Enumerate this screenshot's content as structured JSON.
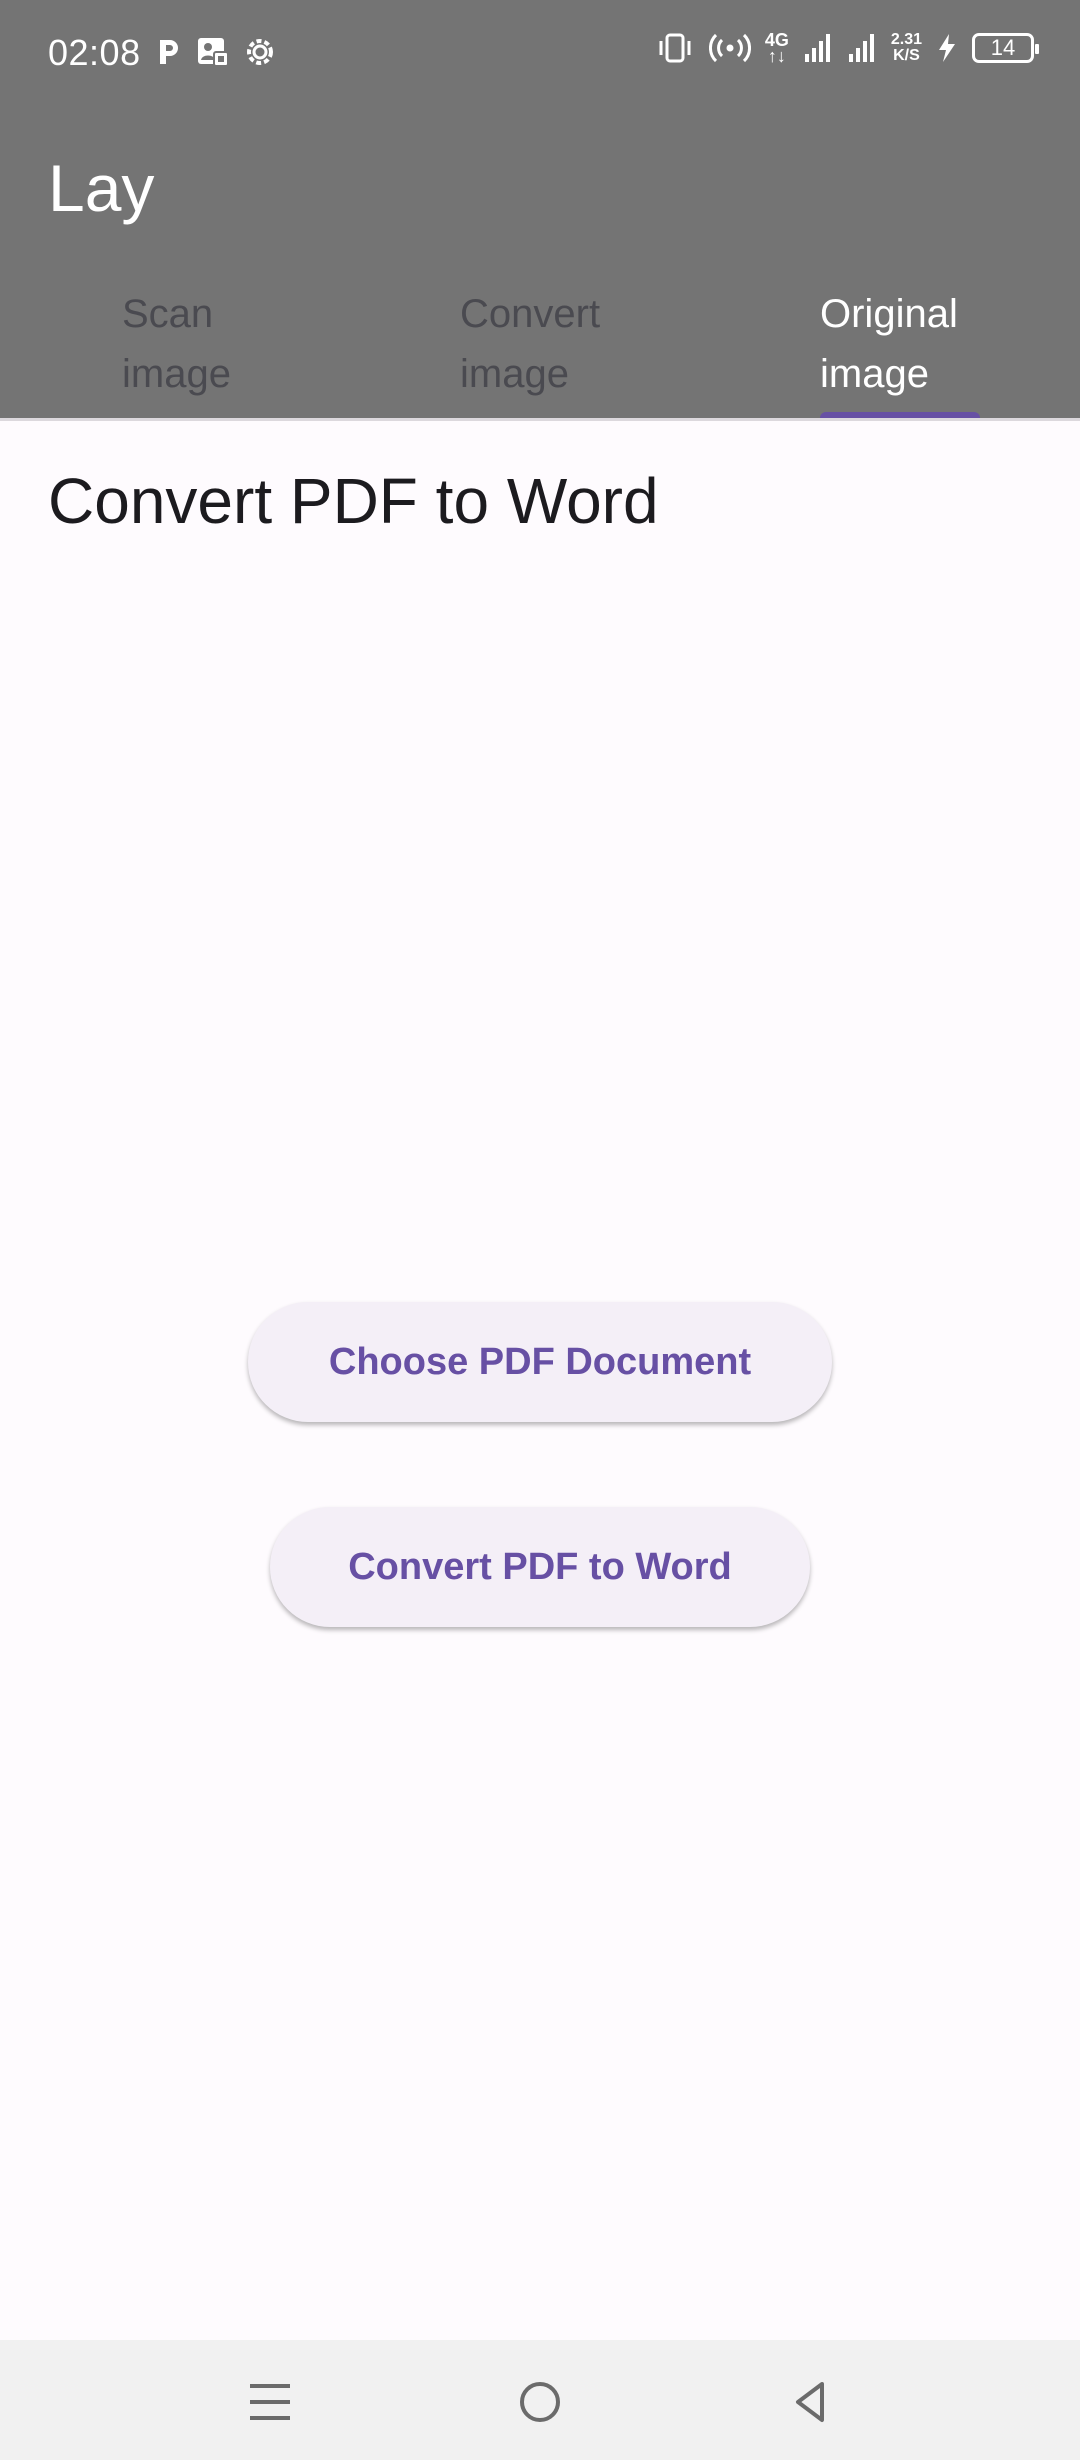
{
  "status_bar": {
    "time": "02:08",
    "network_type": "4G",
    "speed_value": "2.31",
    "speed_unit": "K/S",
    "battery_level": "14"
  },
  "app": {
    "title": "Lay"
  },
  "tabs": [
    {
      "label": "Scan image",
      "selected": false
    },
    {
      "label": "Convert image",
      "selected": false
    },
    {
      "label": "Original image",
      "selected": true
    }
  ],
  "main": {
    "heading": "Convert PDF to Word",
    "choose_button": "Choose PDF Document",
    "convert_button": "Convert PDF to Word"
  },
  "colors": {
    "appbar": "#747474",
    "accent": "#6750a4",
    "background": "#fefbfe",
    "button_bg": "#f4eff7"
  },
  "nav_icons": [
    "menu-icon",
    "home-icon",
    "back-icon"
  ]
}
